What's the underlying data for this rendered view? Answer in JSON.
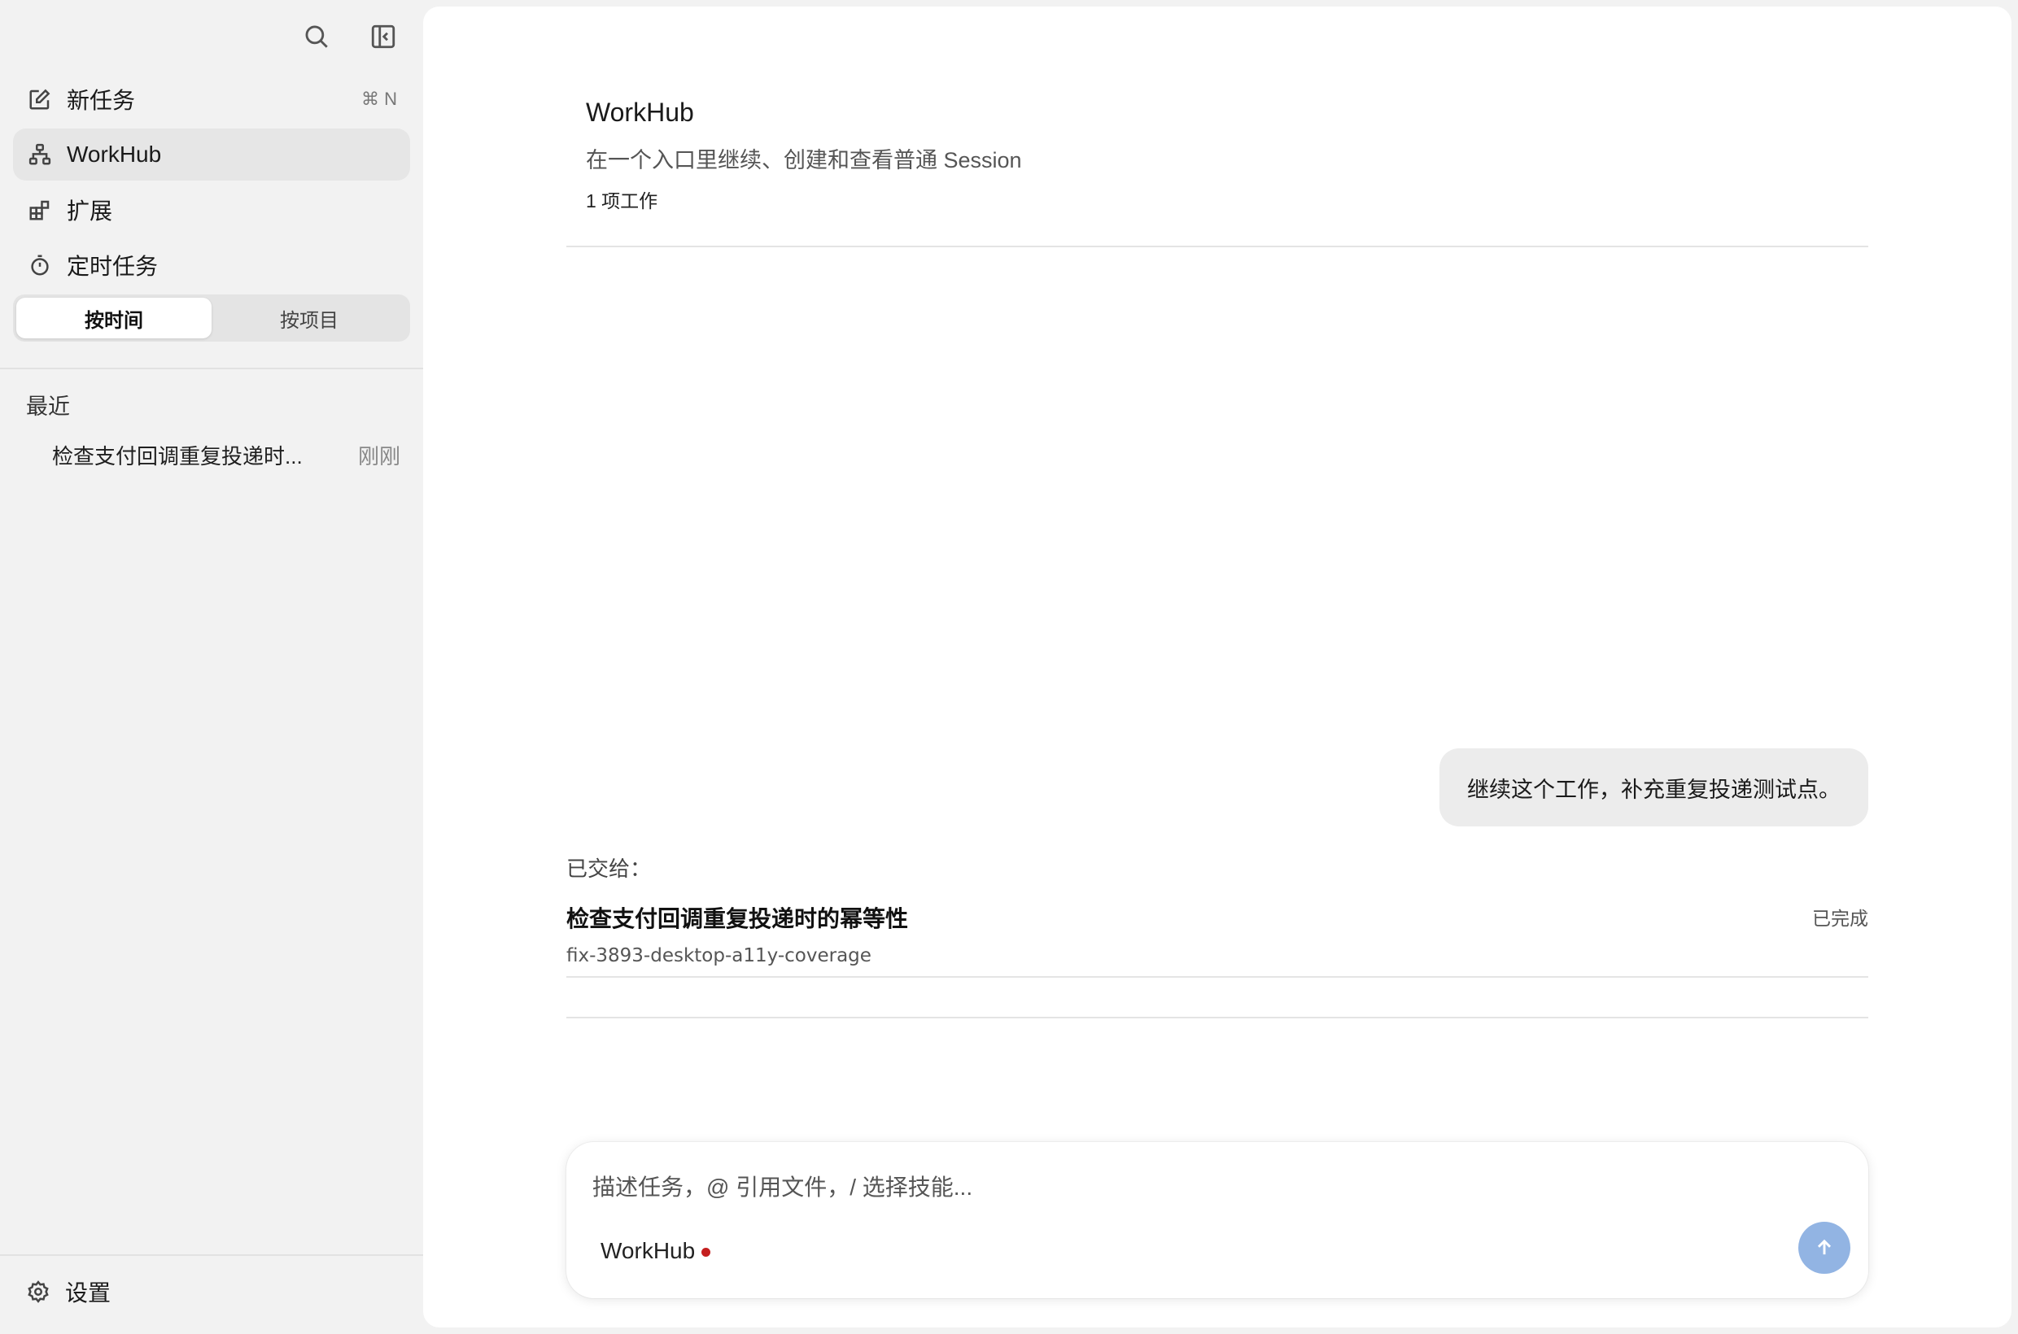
{
  "sidebar": {
    "nav": [
      {
        "label": "新任务",
        "icon": "edit-icon",
        "shortcut": "⌘ N"
      },
      {
        "label": "WorkHub",
        "icon": "hierarchy-icon"
      },
      {
        "label": "扩展",
        "icon": "extensions-icon"
      },
      {
        "label": "定时任务",
        "icon": "timer-icon"
      }
    ],
    "segments": [
      "按时间",
      "按项目"
    ],
    "recent_heading": "最近",
    "recent": [
      {
        "title": "检查支付回调重复投递时...",
        "time": "刚刚"
      }
    ],
    "settings_label": "设置"
  },
  "main": {
    "title": "WorkHub",
    "subtitle": "在一个入口里继续、创建和查看普通 Session",
    "count": "1 项工作",
    "message": "继续这个工作，补充重复投递测试点。",
    "handoff_label": "已交给：",
    "task": {
      "title": "检查支付回调重复投递时的幂等性",
      "branch": "fix-3893-desktop-a11y-coverage",
      "status": "已完成"
    },
    "composer": {
      "placeholder": "描述任务，@ 引用文件，/ 选择技能...",
      "context_label": "WorkHub"
    }
  },
  "colors": {
    "send_button": "#92b4e3",
    "status_dot": "#c41f1f",
    "active_nav_bg": "#e6e6e6"
  }
}
